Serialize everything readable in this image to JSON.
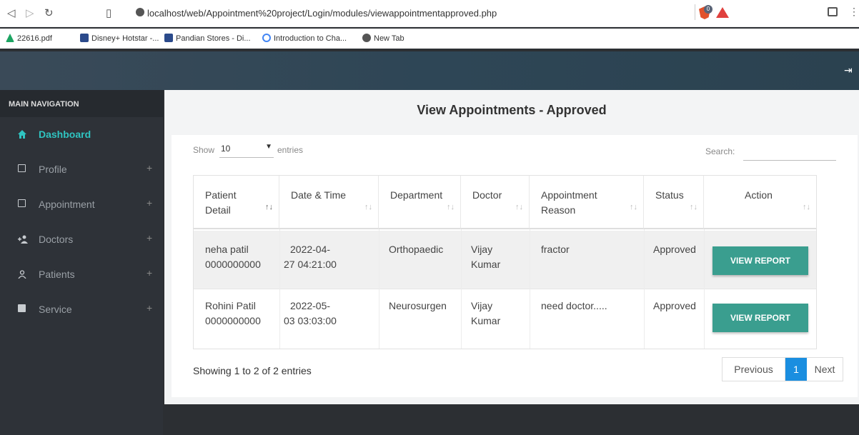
{
  "browser": {
    "url": "localhost/web/Appointment%20project/Login/modules/viewappointmentapproved.php",
    "badge_count": "0",
    "bookmarks": [
      {
        "label": "22616.pdf",
        "icon": "drive-icon",
        "color": "#1da462"
      },
      {
        "label": "Disney+ Hotstar -...",
        "icon": "eh-icon",
        "color": "#2b4a8b"
      },
      {
        "label": "Pandian Stores - Di...",
        "icon": "eh-icon",
        "color": "#2b4a8b"
      },
      {
        "label": "Introduction to Cha...",
        "icon": "google-icon",
        "color": "#4285f4"
      },
      {
        "label": "New Tab",
        "icon": "globe-icon",
        "color": "#555555"
      }
    ]
  },
  "sidebar": {
    "heading": "MAIN NAVIGATION",
    "items": [
      {
        "label": "Dashboard",
        "icon": "home-icon",
        "active": true
      },
      {
        "label": "Profile",
        "icon": "calendar-icon"
      },
      {
        "label": "Appointment",
        "icon": "calendar-icon"
      },
      {
        "label": "Doctors",
        "icon": "add-user-icon"
      },
      {
        "label": "Patients",
        "icon": "user-icon"
      },
      {
        "label": "Service",
        "icon": "square-icon"
      }
    ],
    "plus": "+"
  },
  "main": {
    "title": "View Appointments - Approved",
    "show_label": "Show",
    "page_size": "10",
    "entries_label": "entries",
    "search_label": "Search:",
    "search_value": "",
    "columns": [
      {
        "l1": "Patient",
        "l2": "Detail"
      },
      {
        "l1": "Date & Time",
        "l2": ""
      },
      {
        "l1": "Department",
        "l2": ""
      },
      {
        "l1": "Doctor",
        "l2": ""
      },
      {
        "l1": "Appointment",
        "l2": "Reason"
      },
      {
        "l1": "Status",
        "l2": ""
      },
      {
        "l1": "Action",
        "l2": ""
      }
    ],
    "sort_glyph": "↑↓",
    "rows": [
      {
        "patient_name": "neha patil",
        "patient_phone": "0000000000",
        "date": "2022-04-",
        "time": "27 04:21:00",
        "department": "Orthopaedic",
        "doctor_first": "Vijay",
        "doctor_last": "Kumar",
        "reason": "fractor",
        "status": "Approved",
        "action": "VIEW REPORT"
      },
      {
        "patient_name": "Rohini Patil",
        "patient_phone": "0000000000",
        "date": "2022-05-",
        "time": "03 03:03:00",
        "department": "Neurosurgen",
        "doctor_first": "Vijay",
        "doctor_last": "Kumar",
        "reason": "need doctor.....",
        "status": "Approved",
        "action": "VIEW REPORT"
      }
    ],
    "info": "Showing 1 to 2 of 2 entries",
    "pager": {
      "prev": "Previous",
      "current": "1",
      "next": "Next"
    }
  },
  "colors": {
    "accent": "#2fc4c1",
    "button": "#3a9e8f",
    "pager_active": "#1a8ee0"
  }
}
